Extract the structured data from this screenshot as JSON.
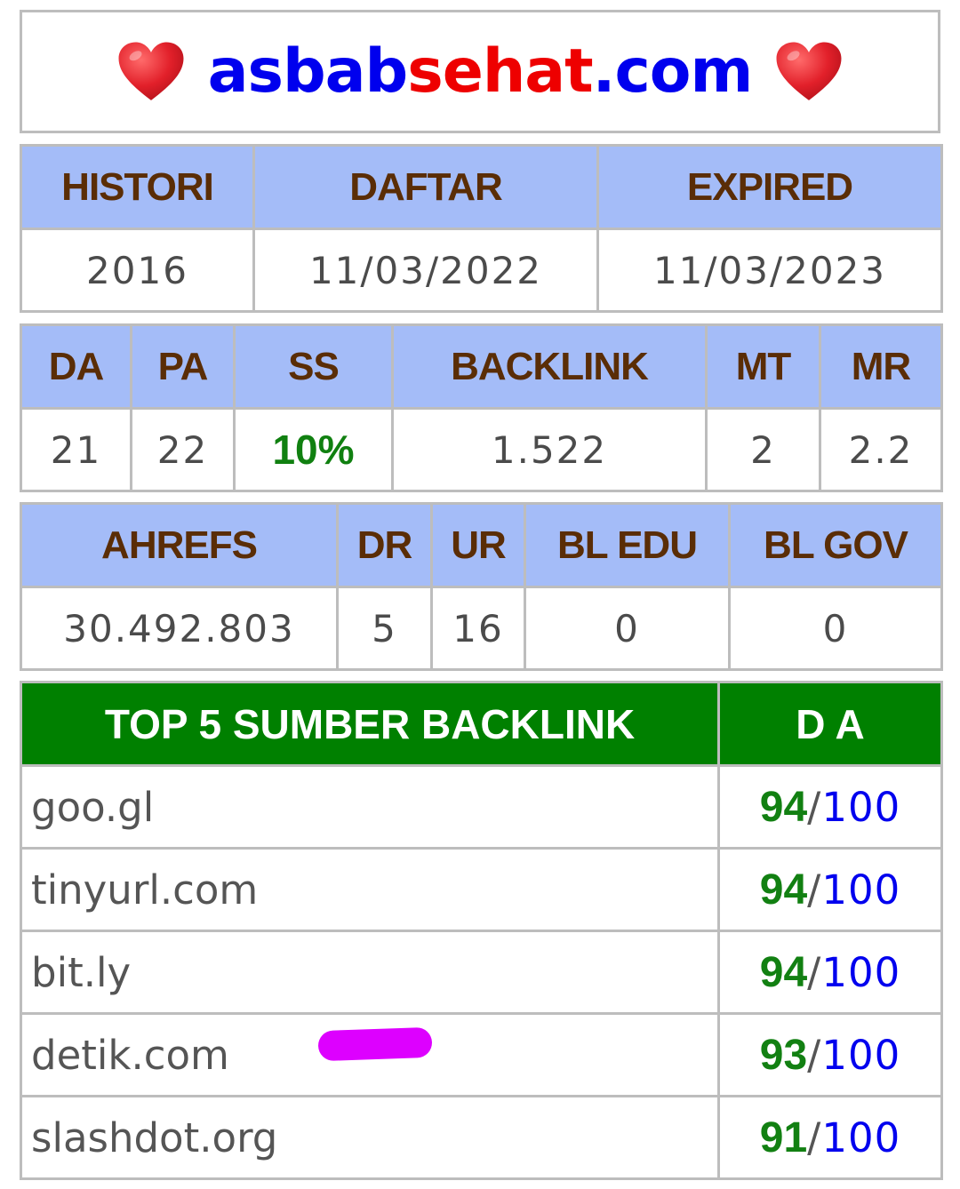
{
  "site": {
    "name_part1": "asbab",
    "name_part2": "sehat",
    "name_part3": ".com",
    "heart_icon": "heart-icon",
    "colors": {
      "blue": "#0000ee",
      "red": "#ee0000"
    }
  },
  "domain_info": {
    "headers": [
      "HISTORI",
      "DAFTAR",
      "EXPIRED"
    ],
    "values": [
      "2016",
      "11/03/2022",
      "11/03/2023"
    ]
  },
  "moz": {
    "headers": [
      "DA",
      "PA",
      "SS",
      "BACKLINK",
      "MT",
      "MR"
    ],
    "values": [
      "21",
      "22",
      "10%",
      "1.522",
      "2",
      "2.2"
    ]
  },
  "ahrefs": {
    "headers": [
      "AHREFS",
      "DR",
      "UR",
      "BL EDU",
      "BL GOV"
    ],
    "values": [
      "30.492.803",
      "5",
      "16",
      "0",
      "0"
    ]
  },
  "backlinks": {
    "headers": [
      "TOP 5 SUMBER BACKLINK",
      "D A"
    ],
    "rows": [
      {
        "source": "goo.gl",
        "score": "94",
        "slash": "/",
        "max": "100"
      },
      {
        "source": "tinyurl.com",
        "score": "94",
        "slash": "/",
        "max": "100"
      },
      {
        "source": "bit.ly",
        "score": "94",
        "slash": "/",
        "max": "100"
      },
      {
        "source": "detik.com",
        "score": "93",
        "slash": "/",
        "max": "100"
      },
      {
        "source": "slashdot.org",
        "score": "91",
        "slash": "/",
        "max": "100"
      }
    ]
  },
  "theme": {
    "header_bg": "#a4bcf8",
    "header_text": "#5a2d06",
    "backlink_header_bg": "#008000",
    "score_color": "#128012",
    "marker_color": "#dd00ff"
  }
}
